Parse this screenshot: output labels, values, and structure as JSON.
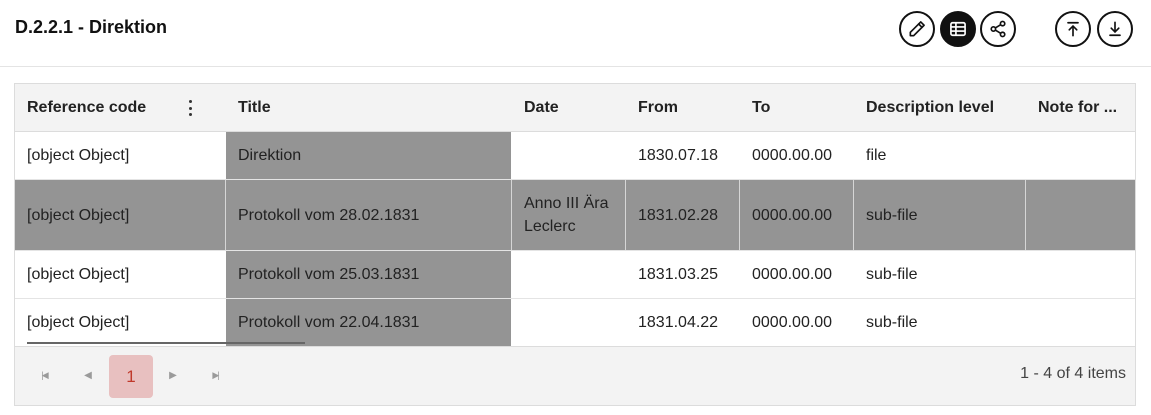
{
  "header": {
    "title": "D.2.2.1 - Direktion",
    "icons": [
      "edit-icon",
      "table-view-icon",
      "share-icon",
      "scroll-top-icon",
      "scroll-bottom-icon"
    ]
  },
  "table": {
    "columns": [
      "Reference code",
      "Title",
      "Date",
      "From",
      "To",
      "Description level",
      "Note for ..."
    ],
    "rows": [
      {
        "ref": "[object Object]",
        "title": "Direktion",
        "date": "",
        "from": "1830.07.18",
        "to": "0000.00.00",
        "level": "file",
        "note": ""
      },
      {
        "ref": "[object Object]",
        "title": "Protokoll vom 28.02.1831",
        "date": "Anno III Ära Leclerc",
        "from": "1831.02.28",
        "to": "0000.00.00",
        "level": "sub-file",
        "note": ""
      },
      {
        "ref": "[object Object]",
        "title": "Protokoll vom 25.03.1831",
        "date": "",
        "from": "1831.03.25",
        "to": "0000.00.00",
        "level": "sub-file",
        "note": ""
      },
      {
        "ref": "[object Object]",
        "title": "Protokoll vom 22.04.1831",
        "date": "",
        "from": "1831.04.22",
        "to": "0000.00.00",
        "level": "sub-file",
        "note": ""
      }
    ]
  },
  "pager": {
    "current_page": "1",
    "info": "1 - 4 of 4 items"
  },
  "colors": {
    "selection": "#949494",
    "active_page_bg": "#e8c0c0",
    "active_page_text": "#c0392b"
  }
}
